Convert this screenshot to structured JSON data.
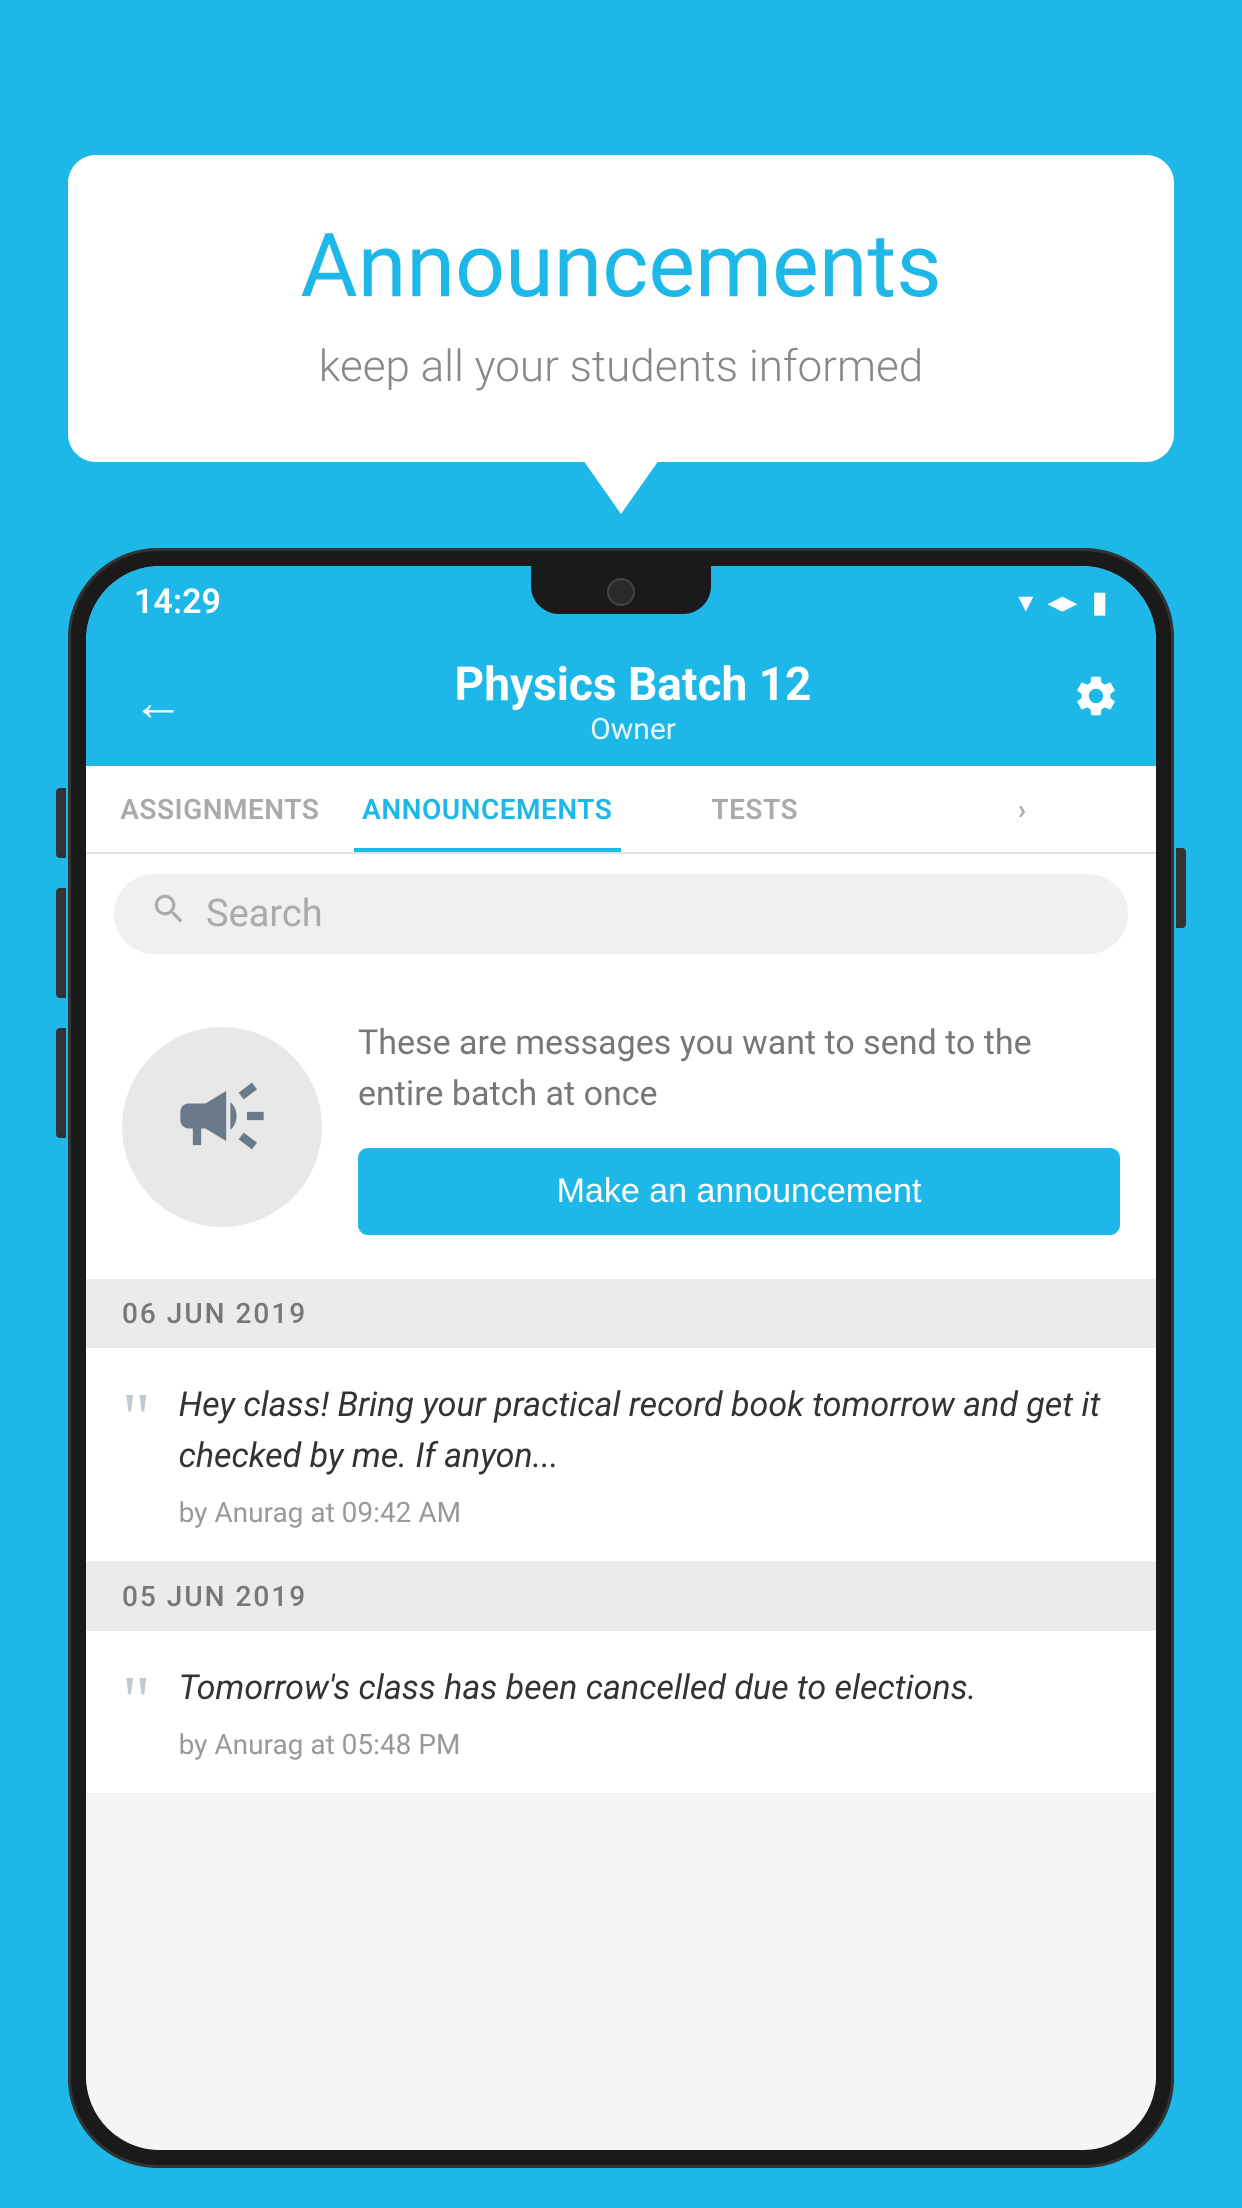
{
  "bubble": {
    "title": "Announcements",
    "subtitle": "keep all your students informed"
  },
  "status_bar": {
    "time": "14:29",
    "wifi": "▾",
    "signal": "▴",
    "battery": "▮"
  },
  "app_bar": {
    "title": "Physics Batch 12",
    "subtitle": "Owner",
    "back_label": "←",
    "settings_label": "⚙"
  },
  "tabs": [
    {
      "label": "ASSIGNMENTS",
      "active": false
    },
    {
      "label": "ANNOUNCEMENTS",
      "active": true
    },
    {
      "label": "TESTS",
      "active": false
    },
    {
      "label": "•••",
      "active": false
    }
  ],
  "search": {
    "placeholder": "Search"
  },
  "promo": {
    "text": "These are messages you want to send to the entire batch at once",
    "button_label": "Make an announcement"
  },
  "announcements": [
    {
      "date": "06  JUN  2019",
      "text": "Hey class! Bring your practical record book tomorrow and get it checked by me. If anyon...",
      "meta": "by Anurag at 09:42 AM"
    },
    {
      "date": "05  JUN  2019",
      "text": "Tomorrow's class has been cancelled due to elections.",
      "meta": "by Anurag at 05:48 PM"
    }
  ],
  "colors": {
    "accent": "#1db8e8",
    "bg": "#1db8e8"
  }
}
